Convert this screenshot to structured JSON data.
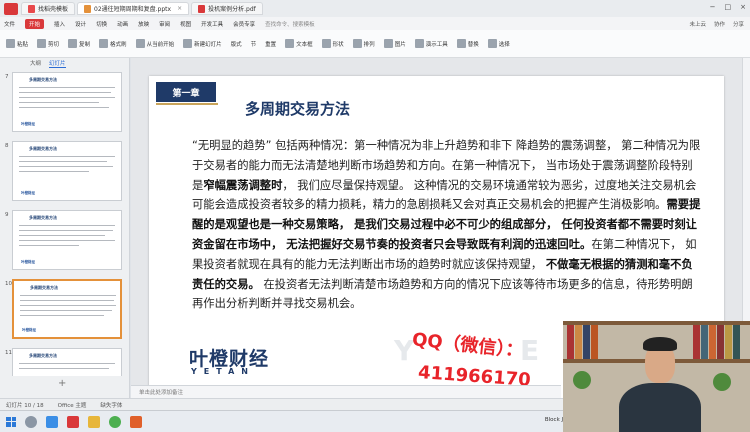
{
  "titlebar": {
    "tabs": [
      {
        "label": "找稻壳模板",
        "color": "#e8484b"
      },
      {
        "label": "02通往短期周期和复盘.pptx",
        "color": "#e4913a",
        "active": true
      },
      {
        "label": "投机案例分析.pdf",
        "color": "#d9383a"
      }
    ],
    "controls": [
      "−",
      "□",
      "×"
    ]
  },
  "menubar": {
    "items": [
      "文件",
      "开始",
      "插入",
      "设计",
      "切换",
      "动画",
      "放映",
      "审阅",
      "视图",
      "开发工具",
      "会员专享"
    ],
    "search": "查找命令、搜索模板",
    "right_items": [
      "未上云",
      "协作",
      "分享"
    ]
  },
  "toolbar": {
    "items": [
      "粘贴",
      "剪切",
      "复制",
      "格式刷",
      "从当前开始",
      "新建幻灯片",
      "版式",
      "节",
      "重置",
      "文本框",
      "形状",
      "排列",
      "图片",
      "演示工具",
      "替换",
      "选择"
    ]
  },
  "leftpanel": {
    "tabs": [
      "大纲",
      "幻灯片"
    ],
    "slides": [
      {
        "num": "7",
        "title": "多周期交易方法",
        "sig": "叶橙财经"
      },
      {
        "num": "8",
        "title": "多周期交易方法",
        "sig": "叶橙财经"
      },
      {
        "num": "9",
        "title": "多周期交易方法",
        "sig": "叶橙财经"
      },
      {
        "num": "10",
        "title": "多周期交易方法",
        "sig": "叶橙财经"
      },
      {
        "num": "11",
        "title": "多周期交易方法",
        "sig": ""
      }
    ]
  },
  "slide": {
    "chapter": "第一章",
    "title": "多周期交易方法",
    "brand_cn": "叶橙财经",
    "brand_en": "YETAN",
    "watermark": "Y E T",
    "qq": "QQ（微信）：",
    "qq_number": "411966170",
    "body": [
      {
        "t": "“无明显的趋势” 包括两种情况：第一种情况为非上升趋势和非下 降趋势的震荡调整， 第二种情况为限于交易者的能力而无法清楚地判断市场趋势和方向。在第一种情况下， 当市场处于震荡调整阶段特别是",
        "b": false
      },
      {
        "t": "窄幅震荡调整时",
        "b": true
      },
      {
        "t": "， 我们应尽量保持观望。 这种情况的交易环境通常较为恶劣，过度地关注交易机会可能会造成投资者较多的精力损耗，精力的急剧损耗又会对真正交易机会的把握产生消极影响。",
        "b": false
      },
      {
        "t": "需要提醒的是观望也是一种交易策略， 是我们交易过程中必不可少的组成部分， 任何投资者都不需要时刻让资金留在市场中， 无法把握好交易节奏的投资者只会导致既有利润的迅速回吐。",
        "b": true
      },
      {
        "t": "在第二种情况下， 如果投资者就现在具有的能力无法判断出市场的趋势时就应该保持观望， ",
        "b": false
      },
      {
        "t": "不做毫无根据的猜测和毫不负责任的交易。",
        "b": true
      },
      {
        "t": " 在投资者无法判断清楚市场趋势和方向的情况下应该等待市场更多的信息，待形势明朗再作出分析判断并寻找交易机会。",
        "b": false
      }
    ]
  },
  "notesbar": {
    "placeholder": "单击此处添加备注"
  },
  "statusbar": {
    "page": "幻灯片 10 / 18",
    "theme": "Office 主题",
    "font_missing": "缺失字体"
  },
  "taskbar": {
    "tray_text": "Block Joker - Google"
  }
}
